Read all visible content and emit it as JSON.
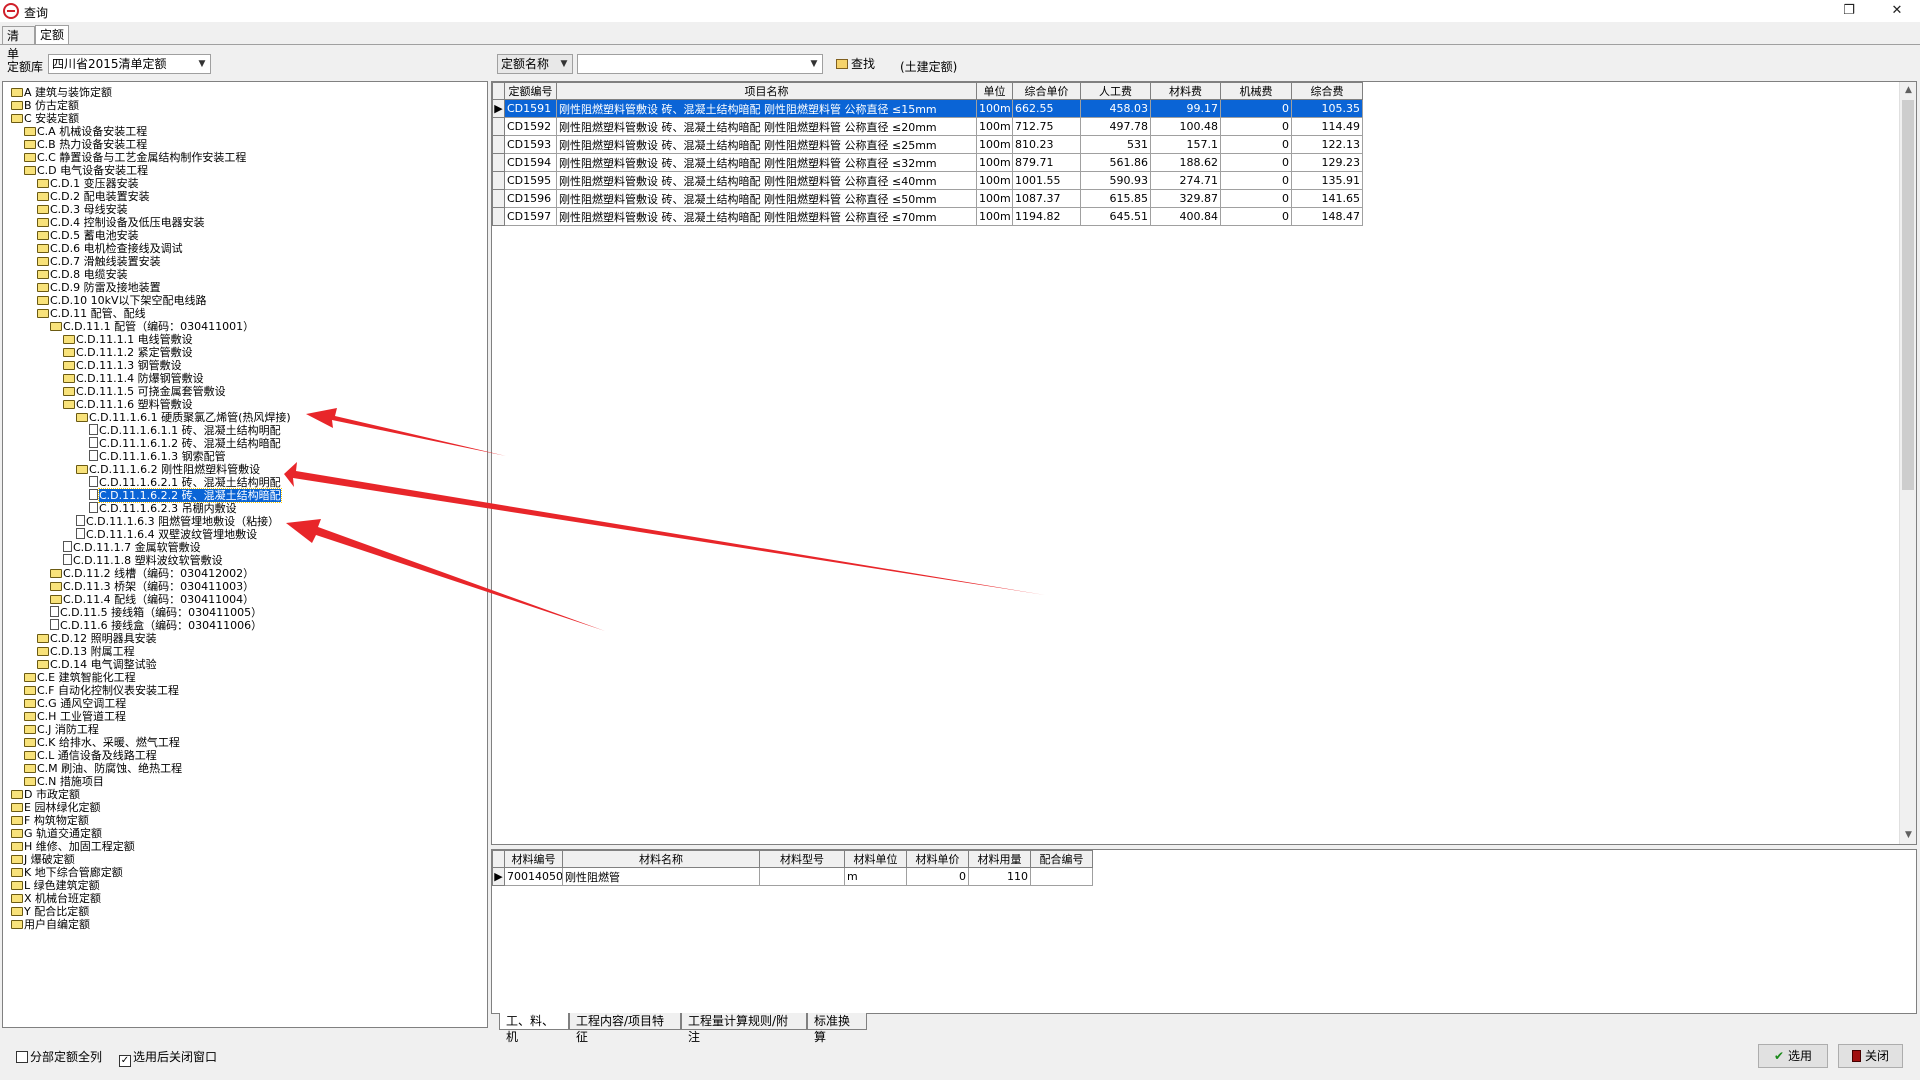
{
  "window": {
    "title": "查询",
    "btn_restore": "❐",
    "btn_close": "✕"
  },
  "tabs": [
    {
      "label": "清单"
    },
    {
      "label": "定额"
    }
  ],
  "filter": {
    "library_label": "定额库",
    "library_value": "四川省2015清单定额",
    "search_field": "定额名称",
    "search_value": "",
    "find_label": "查找",
    "tag_label": "(土建定额)"
  },
  "tree": [
    {
      "d": 0,
      "t": "A 建筑与装饰定额",
      "ic": "folder"
    },
    {
      "d": 0,
      "t": "B 仿古定额",
      "ic": "folder"
    },
    {
      "d": 0,
      "t": "C 安装定额",
      "ic": "folder"
    },
    {
      "d": 1,
      "t": "C.A 机械设备安装工程",
      "ic": "folder"
    },
    {
      "d": 1,
      "t": "C.B 热力设备安装工程",
      "ic": "folder"
    },
    {
      "d": 1,
      "t": "C.C 静置设备与工艺金属结构制作安装工程",
      "ic": "folder"
    },
    {
      "d": 1,
      "t": "C.D 电气设备安装工程",
      "ic": "folder"
    },
    {
      "d": 2,
      "t": "C.D.1 变压器安装",
      "ic": "folder"
    },
    {
      "d": 2,
      "t": "C.D.2 配电装置安装",
      "ic": "folder"
    },
    {
      "d": 2,
      "t": "C.D.3 母线安装",
      "ic": "folder"
    },
    {
      "d": 2,
      "t": "C.D.4 控制设备及低压电器安装",
      "ic": "folder"
    },
    {
      "d": 2,
      "t": "C.D.5 蓄电池安装",
      "ic": "folder"
    },
    {
      "d": 2,
      "t": "C.D.6 电机检查接线及调试",
      "ic": "folder"
    },
    {
      "d": 2,
      "t": "C.D.7 滑触线装置安装",
      "ic": "folder"
    },
    {
      "d": 2,
      "t": "C.D.8 电缆安装",
      "ic": "folder"
    },
    {
      "d": 2,
      "t": "C.D.9 防雷及接地装置",
      "ic": "folder"
    },
    {
      "d": 2,
      "t": "C.D.10 10kV以下架空配电线路",
      "ic": "folder"
    },
    {
      "d": 2,
      "t": "C.D.11 配管、配线",
      "ic": "folder"
    },
    {
      "d": 3,
      "t": "C.D.11.1 配管（编码：030411001）",
      "ic": "folder"
    },
    {
      "d": 4,
      "t": "C.D.11.1.1 电线管敷设",
      "ic": "folder"
    },
    {
      "d": 4,
      "t": "C.D.11.1.2 紧定管敷设",
      "ic": "folder"
    },
    {
      "d": 4,
      "t": "C.D.11.1.3 钢管敷设",
      "ic": "folder"
    },
    {
      "d": 4,
      "t": "C.D.11.1.4 防爆钢管敷设",
      "ic": "folder"
    },
    {
      "d": 4,
      "t": "C.D.11.1.5 可挠金属套管敷设",
      "ic": "folder"
    },
    {
      "d": 4,
      "t": "C.D.11.1.6 塑料管敷设",
      "ic": "folder"
    },
    {
      "d": 5,
      "t": "C.D.11.1.6.1 硬质聚氯乙烯管(热风焊接)",
      "ic": "folder"
    },
    {
      "d": 6,
      "t": "C.D.11.1.6.1.1 砖、混凝土结构明配",
      "ic": "doc"
    },
    {
      "d": 6,
      "t": "C.D.11.1.6.1.2 砖、混凝土结构暗配",
      "ic": "doc"
    },
    {
      "d": 6,
      "t": "C.D.11.1.6.1.3 钢索配管",
      "ic": "doc"
    },
    {
      "d": 5,
      "t": "C.D.11.1.6.2 刚性阻燃塑料管敷设",
      "ic": "folder"
    },
    {
      "d": 6,
      "t": "C.D.11.1.6.2.1 砖、混凝土结构明配",
      "ic": "doc"
    },
    {
      "d": 6,
      "t": "C.D.11.1.6.2.2 砖、混凝土结构暗配",
      "ic": "doc",
      "sel": true
    },
    {
      "d": 6,
      "t": "C.D.11.1.6.2.3 吊棚内敷设",
      "ic": "doc"
    },
    {
      "d": 5,
      "t": "C.D.11.1.6.3 阻燃管埋地敷设（粘接）",
      "ic": "doc"
    },
    {
      "d": 5,
      "t": "C.D.11.1.6.4 双壁波纹管埋地敷设",
      "ic": "doc"
    },
    {
      "d": 4,
      "t": "C.D.11.1.7 金属软管敷设",
      "ic": "doc"
    },
    {
      "d": 4,
      "t": "C.D.11.1.8 塑料波纹软管敷设",
      "ic": "doc"
    },
    {
      "d": 3,
      "t": "C.D.11.2 线槽（编码：030412002）",
      "ic": "folder"
    },
    {
      "d": 3,
      "t": "C.D.11.3 桥架（编码：030411003）",
      "ic": "folder"
    },
    {
      "d": 3,
      "t": "C.D.11.4 配线（编码：030411004）",
      "ic": "folder"
    },
    {
      "d": 3,
      "t": "C.D.11.5 接线箱（编码：030411005）",
      "ic": "doc"
    },
    {
      "d": 3,
      "t": "C.D.11.6 接线盒（编码：030411006）",
      "ic": "doc"
    },
    {
      "d": 2,
      "t": "C.D.12 照明器具安装",
      "ic": "folder"
    },
    {
      "d": 2,
      "t": "C.D.13 附属工程",
      "ic": "folder"
    },
    {
      "d": 2,
      "t": "C.D.14 电气调整试验",
      "ic": "folder"
    },
    {
      "d": 1,
      "t": "C.E 建筑智能化工程",
      "ic": "folder"
    },
    {
      "d": 1,
      "t": "C.F 自动化控制仪表安装工程",
      "ic": "folder"
    },
    {
      "d": 1,
      "t": "C.G 通风空调工程",
      "ic": "folder"
    },
    {
      "d": 1,
      "t": "C.H 工业管道工程",
      "ic": "folder"
    },
    {
      "d": 1,
      "t": "C.J 消防工程",
      "ic": "folder"
    },
    {
      "d": 1,
      "t": "C.K 给排水、采暖、燃气工程",
      "ic": "folder"
    },
    {
      "d": 1,
      "t": "C.L 通信设备及线路工程",
      "ic": "folder"
    },
    {
      "d": 1,
      "t": "C.M 刷油、防腐蚀、绝热工程",
      "ic": "folder"
    },
    {
      "d": 1,
      "t": "C.N 措施项目",
      "ic": "folder"
    },
    {
      "d": 0,
      "t": "D 市政定额",
      "ic": "folder"
    },
    {
      "d": 0,
      "t": "E 园林绿化定额",
      "ic": "folder"
    },
    {
      "d": 0,
      "t": "F 构筑物定额",
      "ic": "folder"
    },
    {
      "d": 0,
      "t": "G 轨道交通定额",
      "ic": "folder"
    },
    {
      "d": 0,
      "t": "H 维修、加固工程定额",
      "ic": "folder"
    },
    {
      "d": 0,
      "t": "J 爆破定额",
      "ic": "folder"
    },
    {
      "d": 0,
      "t": "K 地下综合管廊定额",
      "ic": "folder"
    },
    {
      "d": 0,
      "t": "L 绿色建筑定额",
      "ic": "folder"
    },
    {
      "d": 0,
      "t": "X 机械台班定额",
      "ic": "folder"
    },
    {
      "d": 0,
      "t": "Y 配合比定额",
      "ic": "folder"
    },
    {
      "d": 0,
      "t": "用户自编定额",
      "ic": "folder"
    }
  ],
  "quota_grid": {
    "columns": [
      "定额编号",
      "项目名称",
      "单位",
      "综合单价",
      "人工费",
      "材料费",
      "机械费",
      "综合费"
    ],
    "rows": [
      [
        "CD1591",
        "刚性阻燃塑料管敷设 砖、混凝土结构暗配 刚性阻燃塑料管 公称直径 ≤15mm",
        "100m",
        "662.55",
        "458.03",
        "99.17",
        "0",
        "105.35"
      ],
      [
        "CD1592",
        "刚性阻燃塑料管敷设 砖、混凝土结构暗配 刚性阻燃塑料管 公称直径 ≤20mm",
        "100m",
        "712.75",
        "497.78",
        "100.48",
        "0",
        "114.49"
      ],
      [
        "CD1593",
        "刚性阻燃塑料管敷设 砖、混凝土结构暗配 刚性阻燃塑料管 公称直径 ≤25mm",
        "100m",
        "810.23",
        "531",
        "157.1",
        "0",
        "122.13"
      ],
      [
        "CD1594",
        "刚性阻燃塑料管敷设 砖、混凝土结构暗配 刚性阻燃塑料管 公称直径 ≤32mm",
        "100m",
        "879.71",
        "561.86",
        "188.62",
        "0",
        "129.23"
      ],
      [
        "CD1595",
        "刚性阻燃塑料管敷设 砖、混凝土结构暗配 刚性阻燃塑料管 公称直径 ≤40mm",
        "100m",
        "1001.55",
        "590.93",
        "274.71",
        "0",
        "135.91"
      ],
      [
        "CD1596",
        "刚性阻燃塑料管敷设 砖、混凝土结构暗配 刚性阻燃塑料管 公称直径 ≤50mm",
        "100m",
        "1087.37",
        "615.85",
        "329.87",
        "0",
        "141.65"
      ],
      [
        "CD1597",
        "刚性阻燃塑料管敷设 砖、混凝土结构暗配 刚性阻燃塑料管 公称直径 ≤70mm",
        "100m",
        "1194.82",
        "645.51",
        "400.84",
        "0",
        "148.47"
      ]
    ]
  },
  "material_grid": {
    "columns": [
      "材料编号",
      "材料名称",
      "材料型号",
      "材料单位",
      "材料单价",
      "材料用量",
      "配合编号"
    ],
    "rows": [
      [
        "70014050",
        "刚性阻燃管",
        "",
        "m",
        "0",
        "110",
        ""
      ]
    ]
  },
  "bottom_tabs": [
    {
      "label": "工、料、机"
    },
    {
      "label": "工程内容/项目特征"
    },
    {
      "label": "工程量计算规则/附注"
    },
    {
      "label": "标准换算"
    }
  ],
  "footer": {
    "chk_all_label": "分部定额全列",
    "chk_close_label": "选用后关闭窗口",
    "select_label": "选用",
    "close_label": "关闭"
  },
  "colors": {
    "selection": "#0a64d6",
    "annotation_arrow": "#e8262a"
  },
  "icons": [
    "app-icon",
    "folder-icon",
    "document-icon",
    "find-icon",
    "check-icon",
    "exit-icon"
  ]
}
